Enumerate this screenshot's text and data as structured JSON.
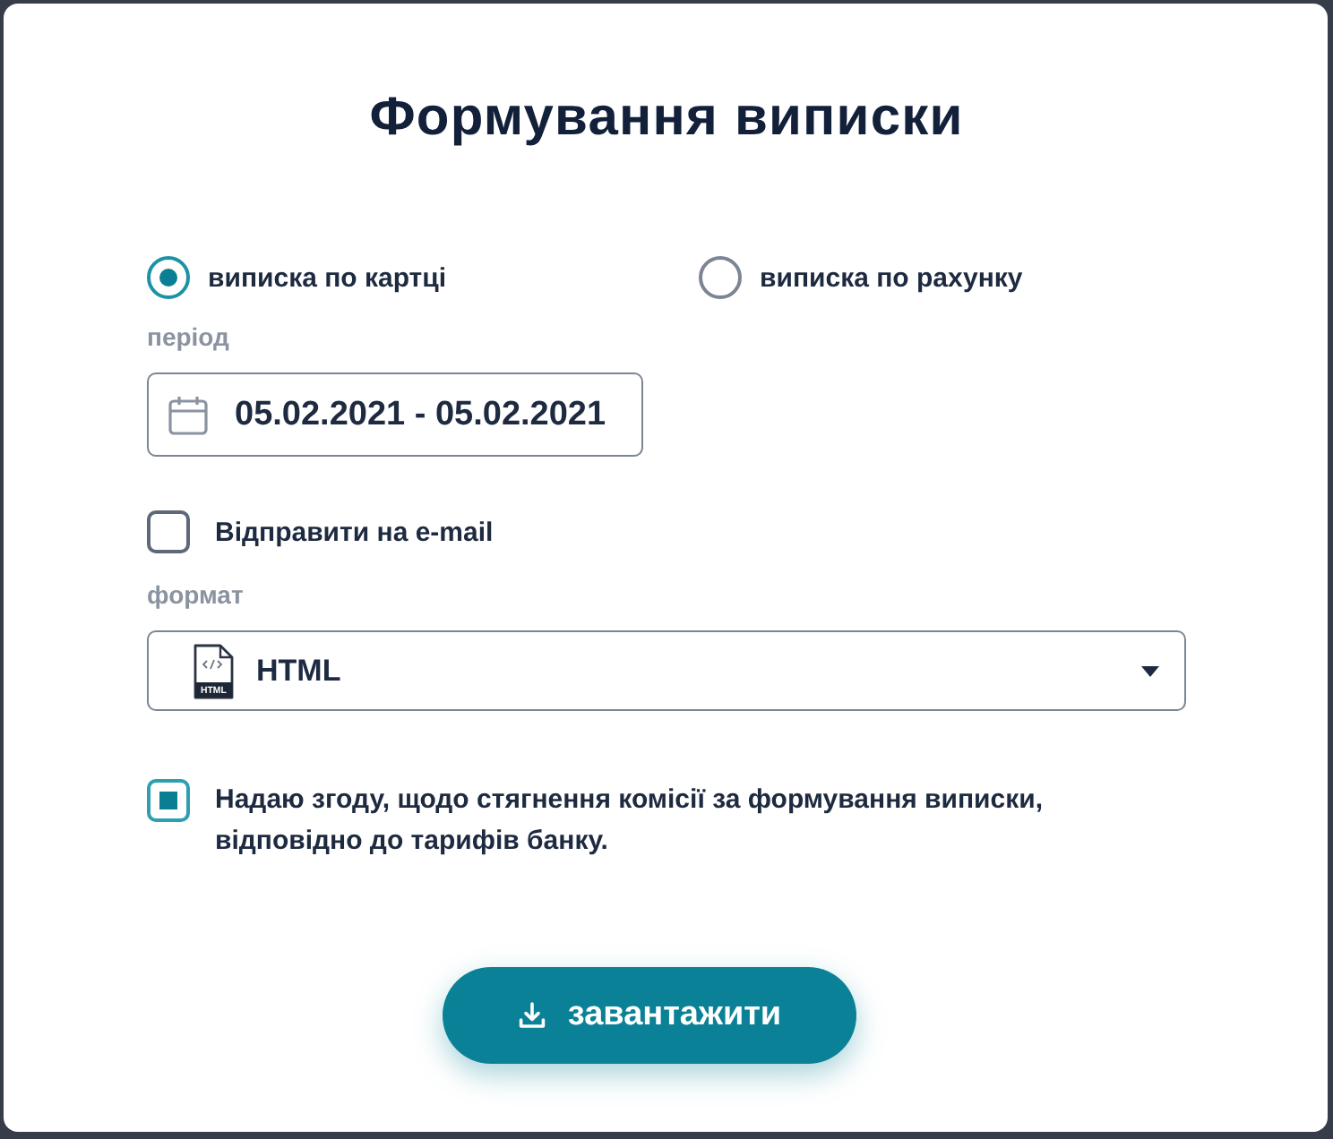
{
  "dialog": {
    "title": "Формування виписки"
  },
  "statement_type": [
    {
      "label": "виписка по картці",
      "selected": true
    },
    {
      "label": "виписка по рахунку",
      "selected": false
    }
  ],
  "period": {
    "label": "період",
    "value": "05.02.2021 - 05.02.2021"
  },
  "email": {
    "label": "Відправити на e-mail",
    "checked": false
  },
  "format": {
    "label": "формат",
    "value": "HTML",
    "icon_text": "HTML"
  },
  "consent": {
    "text": "Надаю згоду, щодо стягнення комісії за формування виписки, відповідно до тарифів банку.",
    "checked": true
  },
  "buttons": [
    {
      "label": "завантажити",
      "kind": "download"
    }
  ]
}
